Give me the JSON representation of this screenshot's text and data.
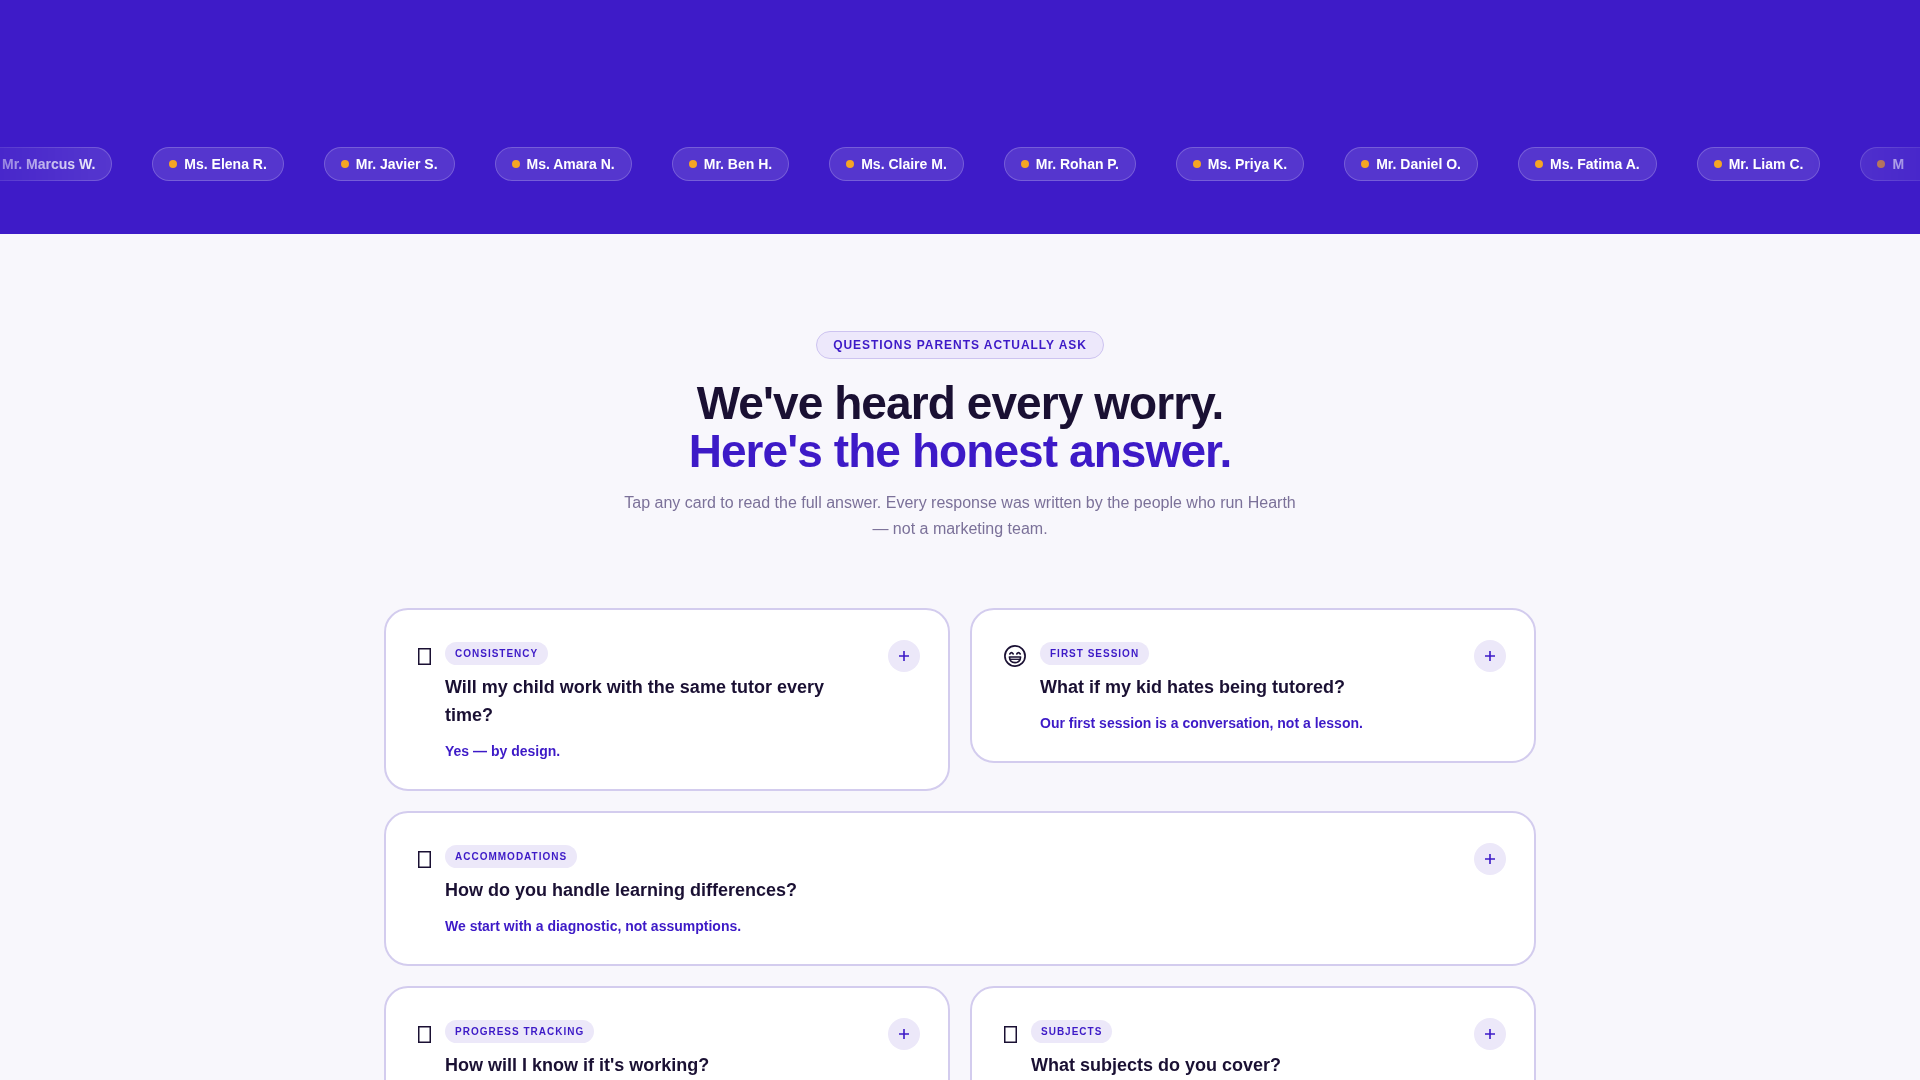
{
  "ticker": {
    "chips": [
      {
        "kind": "leading",
        "name": "Mr. Marcus W."
      },
      {
        "kind": "whole",
        "name": "Ms. Elena R."
      },
      {
        "kind": "whole",
        "name": "Mr. Javier S."
      },
      {
        "kind": "whole",
        "name": "Ms. Amara N."
      },
      {
        "kind": "whole",
        "name": "Mr. Ben H."
      },
      {
        "kind": "whole",
        "name": "Ms. Claire M."
      },
      {
        "kind": "whole",
        "name": "Mr. Rohan P."
      },
      {
        "kind": "whole",
        "name": "Ms. Priya K."
      },
      {
        "kind": "whole",
        "name": "Mr. Daniel O."
      },
      {
        "kind": "whole",
        "name": "Ms. Fatima A."
      },
      {
        "kind": "whole",
        "name": "Mr. Liam C."
      },
      {
        "kind": "trailing",
        "name": "M"
      }
    ]
  },
  "faq": {
    "badge": "QUESTIONS PARENTS ACTUALLY ASK",
    "title": "We've heard every worry.",
    "title_accent": "Here's the honest answer.",
    "subtitle": "Tap any card to read the full answer. Every response was written by the people who run Hearth — not a marketing team.",
    "cards": [
      {
        "tag": "CONSISTENCY",
        "question": "Will my child work with the same tutor every time?",
        "answer": "Yes — by design.",
        "expanded": false
      },
      {
        "tag": "FIRST SESSION",
        "question": "What if my kid hates being tutored?",
        "answer": "Our first session is a conversation, not a lesson.",
        "expanded": false
      },
      {
        "tag": "ACCOMMODATIONS",
        "question": "How do you handle learning differences?",
        "answer": "We start with a diagnostic, not assumptions.",
        "expanded": false
      },
      {
        "tag": "PROGRESS TRACKING",
        "question": "How will I know if it's working?",
        "expanded": false
      },
      {
        "tag": "SUBJECTS",
        "question": "What subjects do you cover?",
        "expanded": false
      }
    ]
  }
}
